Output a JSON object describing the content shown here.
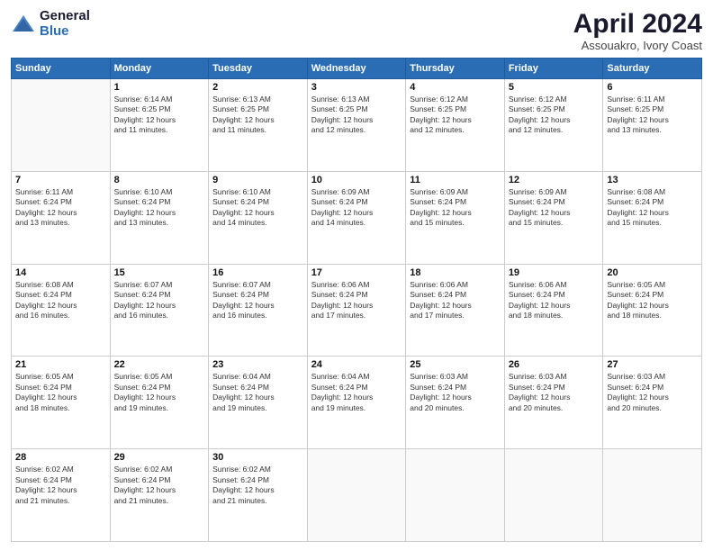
{
  "logo": {
    "general": "General",
    "blue": "Blue"
  },
  "header": {
    "month": "April 2024",
    "location": "Assouakro, Ivory Coast"
  },
  "weekdays": [
    "Sunday",
    "Monday",
    "Tuesday",
    "Wednesday",
    "Thursday",
    "Friday",
    "Saturday"
  ],
  "weeks": [
    [
      {
        "day": "",
        "info": ""
      },
      {
        "day": "1",
        "info": "Sunrise: 6:14 AM\nSunset: 6:25 PM\nDaylight: 12 hours\nand 11 minutes."
      },
      {
        "day": "2",
        "info": "Sunrise: 6:13 AM\nSunset: 6:25 PM\nDaylight: 12 hours\nand 11 minutes."
      },
      {
        "day": "3",
        "info": "Sunrise: 6:13 AM\nSunset: 6:25 PM\nDaylight: 12 hours\nand 12 minutes."
      },
      {
        "day": "4",
        "info": "Sunrise: 6:12 AM\nSunset: 6:25 PM\nDaylight: 12 hours\nand 12 minutes."
      },
      {
        "day": "5",
        "info": "Sunrise: 6:12 AM\nSunset: 6:25 PM\nDaylight: 12 hours\nand 12 minutes."
      },
      {
        "day": "6",
        "info": "Sunrise: 6:11 AM\nSunset: 6:25 PM\nDaylight: 12 hours\nand 13 minutes."
      }
    ],
    [
      {
        "day": "7",
        "info": "Sunrise: 6:11 AM\nSunset: 6:24 PM\nDaylight: 12 hours\nand 13 minutes."
      },
      {
        "day": "8",
        "info": "Sunrise: 6:10 AM\nSunset: 6:24 PM\nDaylight: 12 hours\nand 13 minutes."
      },
      {
        "day": "9",
        "info": "Sunrise: 6:10 AM\nSunset: 6:24 PM\nDaylight: 12 hours\nand 14 minutes."
      },
      {
        "day": "10",
        "info": "Sunrise: 6:09 AM\nSunset: 6:24 PM\nDaylight: 12 hours\nand 14 minutes."
      },
      {
        "day": "11",
        "info": "Sunrise: 6:09 AM\nSunset: 6:24 PM\nDaylight: 12 hours\nand 15 minutes."
      },
      {
        "day": "12",
        "info": "Sunrise: 6:09 AM\nSunset: 6:24 PM\nDaylight: 12 hours\nand 15 minutes."
      },
      {
        "day": "13",
        "info": "Sunrise: 6:08 AM\nSunset: 6:24 PM\nDaylight: 12 hours\nand 15 minutes."
      }
    ],
    [
      {
        "day": "14",
        "info": "Sunrise: 6:08 AM\nSunset: 6:24 PM\nDaylight: 12 hours\nand 16 minutes."
      },
      {
        "day": "15",
        "info": "Sunrise: 6:07 AM\nSunset: 6:24 PM\nDaylight: 12 hours\nand 16 minutes."
      },
      {
        "day": "16",
        "info": "Sunrise: 6:07 AM\nSunset: 6:24 PM\nDaylight: 12 hours\nand 16 minutes."
      },
      {
        "day": "17",
        "info": "Sunrise: 6:06 AM\nSunset: 6:24 PM\nDaylight: 12 hours\nand 17 minutes."
      },
      {
        "day": "18",
        "info": "Sunrise: 6:06 AM\nSunset: 6:24 PM\nDaylight: 12 hours\nand 17 minutes."
      },
      {
        "day": "19",
        "info": "Sunrise: 6:06 AM\nSunset: 6:24 PM\nDaylight: 12 hours\nand 18 minutes."
      },
      {
        "day": "20",
        "info": "Sunrise: 6:05 AM\nSunset: 6:24 PM\nDaylight: 12 hours\nand 18 minutes."
      }
    ],
    [
      {
        "day": "21",
        "info": "Sunrise: 6:05 AM\nSunset: 6:24 PM\nDaylight: 12 hours\nand 18 minutes."
      },
      {
        "day": "22",
        "info": "Sunrise: 6:05 AM\nSunset: 6:24 PM\nDaylight: 12 hours\nand 19 minutes."
      },
      {
        "day": "23",
        "info": "Sunrise: 6:04 AM\nSunset: 6:24 PM\nDaylight: 12 hours\nand 19 minutes."
      },
      {
        "day": "24",
        "info": "Sunrise: 6:04 AM\nSunset: 6:24 PM\nDaylight: 12 hours\nand 19 minutes."
      },
      {
        "day": "25",
        "info": "Sunrise: 6:03 AM\nSunset: 6:24 PM\nDaylight: 12 hours\nand 20 minutes."
      },
      {
        "day": "26",
        "info": "Sunrise: 6:03 AM\nSunset: 6:24 PM\nDaylight: 12 hours\nand 20 minutes."
      },
      {
        "day": "27",
        "info": "Sunrise: 6:03 AM\nSunset: 6:24 PM\nDaylight: 12 hours\nand 20 minutes."
      }
    ],
    [
      {
        "day": "28",
        "info": "Sunrise: 6:02 AM\nSunset: 6:24 PM\nDaylight: 12 hours\nand 21 minutes."
      },
      {
        "day": "29",
        "info": "Sunrise: 6:02 AM\nSunset: 6:24 PM\nDaylight: 12 hours\nand 21 minutes."
      },
      {
        "day": "30",
        "info": "Sunrise: 6:02 AM\nSunset: 6:24 PM\nDaylight: 12 hours\nand 21 minutes."
      },
      {
        "day": "",
        "info": ""
      },
      {
        "day": "",
        "info": ""
      },
      {
        "day": "",
        "info": ""
      },
      {
        "day": "",
        "info": ""
      }
    ]
  ]
}
